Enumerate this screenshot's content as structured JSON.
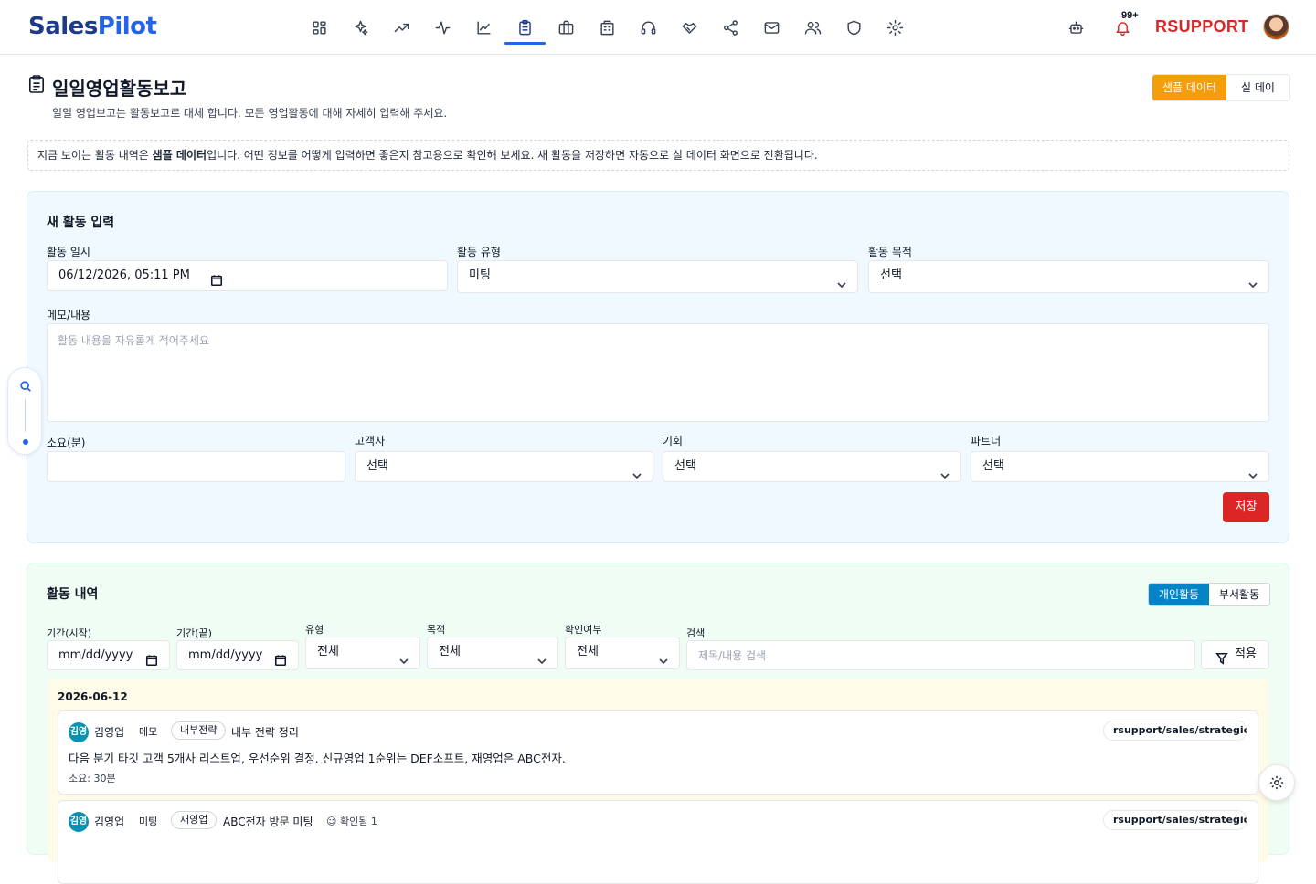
{
  "app": {
    "logo_part1": "Sales",
    "logo_part2": "Pilot",
    "brand": "RSUPPORT",
    "notification_count": "99+"
  },
  "nav_icons": [
    "dashboard-icon",
    "sparkle-icon",
    "trend-up-icon",
    "activity-icon",
    "line-chart-icon",
    "report-icon",
    "briefcase-icon",
    "building-icon",
    "headset-icon",
    "handshake-icon",
    "share-icon",
    "mail-icon",
    "users-icon",
    "shield-icon",
    "settings-icon"
  ],
  "header": {
    "title": "일일영업활동보고",
    "subtitle": "일일 영업보고는 활동보고로 대체 합니다. 모든 영업활동에 대해 자세히 입력해 주세요.",
    "toggle_sample": "샘플 데이터",
    "toggle_real": "실 데이터"
  },
  "notice": {
    "before": "지금 보이는 활동 내역은 ",
    "bold": "샘플 데이터",
    "after": "입니다. 어떤 정보를 어떻게 입력하면 좋은지 참고용으로 확인해 보세요. 새 활동을 저장하면 자동으로 실 데이터 화면으로 전환됩니다."
  },
  "entry": {
    "title": "새 활동 입력",
    "datetime_label": "활동 일시",
    "datetime_value": "06/12/2026, 05:11 PM",
    "type_label": "활동 유형",
    "type_value": "미팅",
    "purpose_label": "활동 목적",
    "purpose_value": "선택",
    "memo_label": "메모/내용",
    "memo_placeholder": "활동 내용을 자유롭게 적어주세요",
    "duration_label": "소요(분)",
    "duration_value": "",
    "customer_label": "고객사",
    "customer_value": "선택",
    "opportunity_label": "기회",
    "opportunity_value": "선택",
    "partner_label": "파트너",
    "partner_value": "선택",
    "save_label": "저장"
  },
  "history": {
    "title": "활동 내역",
    "scope_personal": "개인활동",
    "scope_department": "부서활동",
    "filters": {
      "start_label": "기간(시작)",
      "start_value": "mm/dd/yyyy",
      "end_label": "기간(끝)",
      "end_value": "mm/dd/yyyy",
      "type_label": "유형",
      "type_value": "전체",
      "purpose_label": "목적",
      "purpose_value": "전체",
      "confirm_label": "확인여부",
      "confirm_value": "전체",
      "search_label": "검색",
      "search_placeholder": "제목/내용 검색",
      "apply_label": "적용"
    },
    "date": "2026-06-12",
    "items": [
      {
        "avatar": "김영",
        "author": "김영업",
        "kind": "메모",
        "tag": "내부전략",
        "title": "내부 전략 정리",
        "link": "rsupport/sales/strategic-sales",
        "body": "다음 분기 타깃 고객 5개사 리스트업, 우선순위 결정. 신규영업 1순위는 DEF소프트, 재영업은 ABC전자.",
        "duration": "소요: 30분"
      },
      {
        "avatar": "김영",
        "author": "김영업",
        "kind": "미팅",
        "tag": "재영업",
        "title": "ABC전자 방문 미팅",
        "confirm": "☺ 확인됨 1",
        "link": "rsupport/sales/strategic-sales"
      }
    ]
  }
}
